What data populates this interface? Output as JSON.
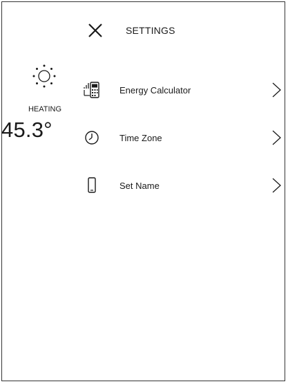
{
  "header": {
    "close_icon": "close-icon",
    "title": "SETTINGS"
  },
  "status": {
    "icon": "sun-icon",
    "mode": "HEATING",
    "temperature": "45.3°"
  },
  "menu": {
    "items": [
      {
        "label": "Energy Calculator",
        "icon": "calculator-phone-icon"
      },
      {
        "label": "Time Zone",
        "icon": "clock-icon"
      },
      {
        "label": "Set Name",
        "icon": "device-icon"
      }
    ],
    "chevron_icon": "chevron-right-icon"
  }
}
